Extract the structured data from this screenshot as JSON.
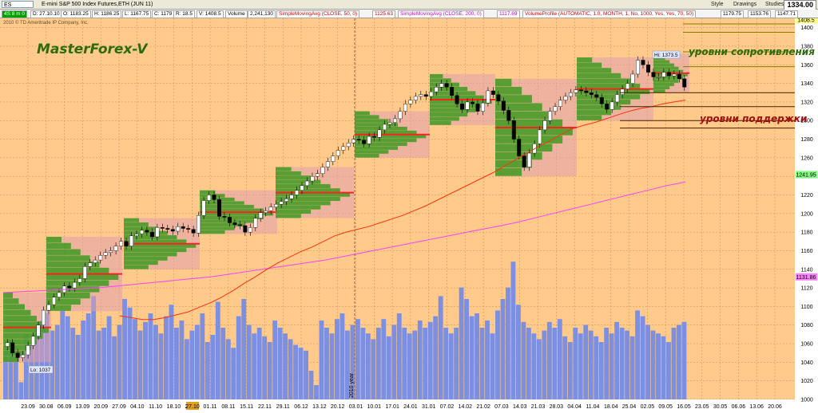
{
  "toolbar": {
    "symbol": "ES",
    "title": "E-mini S&P 500 Index Futures,ETH (JUN 11)",
    "style_label": "Style",
    "drawings_label": "Drawings",
    "studies_label": "Studies",
    "last_price": "1334.00"
  },
  "infobar": {
    "interval": "4S 8 m 0",
    "date": "D: 27.10.10",
    "open": "O: 1183.25",
    "high": "H: 1186.25",
    "low": "L: 1167.75",
    "close": "C: 1179",
    "change": "R: 18.5",
    "volume_label": "V: 1408.5",
    "volume_text": "Volume",
    "volume_value": "2,241,130",
    "sma50_label": "SimpleMovingAvg (CLOSE, 50, 0)",
    "sma50_value": "1125.63",
    "sma200_label": "SimpleMovingAvg (CLOSE, 200, 0)",
    "sma200_value": "1117.69",
    "vp_label": "VolumeProfile (AUTOMATIC, 1.0, MONTH, 1, No, 1000, Yes, Yes, 70, 50)",
    "vp_v1": "1179.75",
    "vp_v2": "1153.76",
    "vp_v3": "1147.71"
  },
  "copyright": "2010 © TD Ameritrade IP Company, Inc.",
  "chart_data": {
    "type": "candlestick",
    "title": "MasterForex-V",
    "year_separator": "2010 year",
    "colors": {
      "background": "#ffca8a",
      "grid": "#c58a50",
      "up": "#00a000",
      "down": "#d00000",
      "sma50": "#ff3010",
      "sma200": "#ff40ff",
      "volume": "#7d8fe0",
      "profile": "#3e9a1e",
      "value_area": "#e0a0b0",
      "support": "#402000",
      "resistance": "#808000"
    },
    "y_axis": {
      "min": 1000,
      "max": 1410,
      "ticks": [
        1000,
        1020,
        1040,
        1060,
        1080,
        1100,
        1120,
        1140,
        1160,
        1180,
        1200,
        1220,
        1240,
        1260,
        1280,
        1300,
        1320,
        1340,
        1360,
        1380,
        1400
      ]
    },
    "x_ticks": [
      "23.09",
      "30.08",
      "06.09",
      "13.09",
      "20.09",
      "27.09",
      "04.10",
      "11.10",
      "18.10",
      "25.10",
      "01.11",
      "08.11",
      "15.11",
      "22.11",
      "29.11",
      "06.12",
      "13.12",
      "20.12",
      "03.01",
      "10.01",
      "17.01",
      "24.01",
      "31.01",
      "07.02",
      "14.02",
      "21.02",
      "07.03",
      "14.03",
      "21.03",
      "28.03",
      "04.04",
      "11.04",
      "18.04",
      "25.04",
      "02.05",
      "09.05",
      "16.05",
      "23.05",
      "30.05",
      "06.06",
      "13.06",
      "20.06"
    ],
    "highlighted_x_tick": "27.10",
    "annotations": {
      "high": "Hi: 1373.5",
      "low": "Lo: 1037",
      "resistance_label": "уровни сопротивления",
      "support_label": "уровни поддержки"
    },
    "price_tags": [
      {
        "value": "1408.5",
        "color": "#ffff80"
      },
      {
        "value": "1241.95",
        "color": "#80ff80"
      },
      {
        "value": "1131.86",
        "color": "#ff80ff"
      }
    ],
    "close_series": [
      1061,
      1050,
      1045,
      1048,
      1058,
      1068,
      1080,
      1096,
      1102,
      1110,
      1115,
      1122,
      1120,
      1126,
      1130,
      1143,
      1147,
      1150,
      1155,
      1158,
      1160,
      1165,
      1170,
      1165,
      1176,
      1178,
      1182,
      1180,
      1175,
      1185,
      1184,
      1183,
      1181,
      1186,
      1184,
      1183,
      1179,
      1198,
      1214,
      1220,
      1215,
      1197,
      1196,
      1190,
      1188,
      1187,
      1180,
      1185,
      1195,
      1201,
      1203,
      1207,
      1210,
      1213,
      1216,
      1220,
      1225,
      1230,
      1235,
      1240,
      1243,
      1250,
      1256,
      1262,
      1268,
      1272,
      1276,
      1280,
      1279,
      1275,
      1283,
      1282,
      1290,
      1296,
      1298,
      1302,
      1310,
      1318,
      1322,
      1326,
      1328,
      1326,
      1331,
      1336,
      1340,
      1336,
      1327,
      1318,
      1312,
      1320,
      1318,
      1310,
      1319,
      1332,
      1328,
      1321,
      1311,
      1300,
      1280,
      1262,
      1250,
      1265,
      1275,
      1290,
      1300,
      1310,
      1315,
      1322,
      1326,
      1330,
      1333,
      1332,
      1330,
      1328,
      1325,
      1318,
      1312,
      1320,
      1328,
      1334,
      1340,
      1350,
      1365,
      1360,
      1352,
      1347,
      1347,
      1352,
      1348,
      1350,
      1345,
      1336
    ],
    "sma50_series": [
      1090,
      1088,
      1086,
      1086,
      1088,
      1091,
      1094,
      1099,
      1104,
      1110,
      1117,
      1125,
      1132,
      1140,
      1147,
      1153,
      1159,
      1164,
      1170,
      1176,
      1180,
      1183,
      1186,
      1190,
      1194,
      1198,
      1203,
      1208,
      1214,
      1220,
      1226,
      1232,
      1238,
      1244,
      1251,
      1258,
      1265,
      1272,
      1278,
      1285,
      1291,
      1295,
      1298,
      1302,
      1306,
      1310,
      1313,
      1315,
      1318,
      1320,
      1322
    ],
    "sma200_series": [
      1115,
      1116,
      1117,
      1118,
      1119,
      1120,
      1122,
      1124,
      1126,
      1128,
      1130,
      1132,
      1135,
      1138,
      1141,
      1144,
      1147,
      1150,
      1154,
      1158,
      1162,
      1166,
      1170,
      1174,
      1178,
      1182,
      1186,
      1190,
      1195,
      1200,
      1205,
      1210,
      1215,
      1220,
      1225,
      1230,
      1234
    ],
    "volume_series": [
      0.35,
      0.42,
      0.28,
      0.12,
      0.45,
      0.38,
      0.5,
      0.55,
      0.6,
      0.48,
      0.52,
      0.62,
      0.58,
      0.5,
      0.45,
      0.55,
      0.6,
      0.72,
      0.48,
      0.5,
      0.58,
      0.44,
      0.52,
      0.7,
      0.64,
      0.56,
      0.48,
      0.54,
      0.6,
      0.52,
      0.46,
      0.58,
      0.66,
      0.5,
      0.55,
      0.42,
      0.48,
      0.52,
      0.6,
      0.4,
      0.45,
      0.68,
      0.5,
      0.42,
      0.36,
      0.58,
      0.7,
      0.52,
      0.46,
      0.5,
      0.44,
      0.4,
      0.55,
      0.5,
      0.46,
      0.42,
      0.38,
      0.36,
      0.34,
      0.2,
      0.1,
      0.55,
      0.5,
      0.46,
      0.56,
      0.6,
      0.48,
      0.52,
      0.56,
      0.5,
      0.46,
      0.42,
      0.5,
      0.56,
      0.44,
      0.52,
      0.6,
      0.5,
      0.46,
      0.48,
      0.55,
      0.5,
      0.54,
      0.58,
      0.72,
      0.5,
      0.46,
      0.5,
      0.78,
      0.7,
      0.58,
      0.6,
      0.5,
      0.55,
      0.46,
      0.62,
      0.7,
      0.78,
      0.96,
      0.66,
      0.54,
      0.5,
      0.46,
      0.42,
      0.48,
      0.54,
      0.5,
      0.56,
      0.44,
      0.4,
      0.5,
      0.46,
      0.52,
      0.48,
      0.44,
      0.4,
      0.5,
      0.46,
      0.54,
      0.5,
      0.48,
      0.44,
      0.62,
      0.58,
      0.52,
      0.48,
      0.46,
      0.44,
      0.4,
      0.5,
      0.52,
      0.54
    ]
  }
}
